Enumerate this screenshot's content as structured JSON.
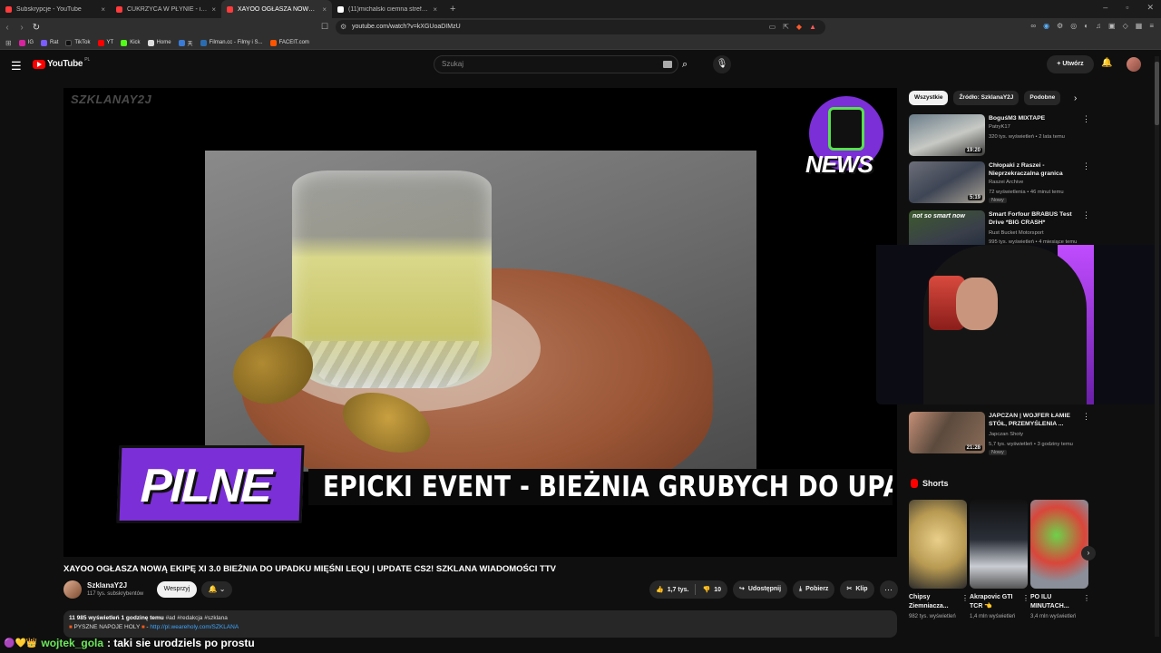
{
  "browser": {
    "tabs": [
      {
        "title": "Subskrypcje - YouTube",
        "color": "#ff3b3b",
        "active": false
      },
      {
        "title": "CUKRZYCA W PŁYNIE - ile kalorii ku...",
        "color": "#ff3b3b",
        "active": false
      },
      {
        "title": "XAYOO OGŁASZA NOWĄ EKI...",
        "color": "#ff3b3b",
        "active": true
      },
      {
        "title": "(11)michalski ciemna strefa (@micha...",
        "color": "#ffffff",
        "active": false
      }
    ],
    "new_tab": "+",
    "url": "youtube.com/watch?v=kXGUoaDIMzU",
    "bookmarks": [
      {
        "label": "IG",
        "color": "#d6249f"
      },
      {
        "label": "Rat",
        "color": "#7b5cff"
      },
      {
        "label": "TikTok",
        "color": "#111111"
      },
      {
        "label": "YT",
        "color": "#ff0000"
      },
      {
        "label": "Kick",
        "color": "#53fc18"
      },
      {
        "label": "Home",
        "color": "#dddddd"
      },
      {
        "label": "天",
        "color": "#3a7bd5"
      },
      {
        "label": "Filman.cc - Filmy i S...",
        "color": "#2b6cb0"
      },
      {
        "label": "FACEIT.com",
        "color": "#ff5500"
      }
    ]
  },
  "youtube": {
    "logo_text": "YouTube",
    "country": "PL",
    "search_placeholder": "Szukaj",
    "create_label": "Utwórz"
  },
  "video": {
    "watermark": "SZKLANAY2J",
    "news_logo": "NEWS",
    "badge": "PILNE",
    "ticker": "EPICKI EVENT - BIEŻNIA GRUBYCH DO UPADKU M",
    "title": "XAYOO OGŁASZA NOWĄ EKIPĘ XI 3.0 BIEŻNIA DO UPADKU MIĘŚNI LEQU | UPDATE CS2! SZKLANA WIADOMOŚCI TTV",
    "channel": "SzklanaY2J",
    "subscribers": "117 tys. subskrybentów",
    "support_label": "Wesprzyj",
    "likes": "1,7 tys.",
    "dislikes": "10",
    "share_label": "Udostępnij",
    "download_label": "Pobierz",
    "clip_label": "Klip",
    "desc_views": "11 985 wyświetleń  1 godzinę temu",
    "desc_tags": " #ad #redakcja #szklana",
    "desc_line2_prefix": "PYSZNE NAPOJE HOLY",
    "desc_line2_link": "http://pl.weareholy.com/SZKLANA"
  },
  "sidebar": {
    "chips": [
      "Wszystkie",
      "Źródło: SzklanaY2J",
      "Podobne"
    ],
    "recommendations": [
      {
        "title": "BoguśM3 MIXTAPE",
        "channel": "PatryK17",
        "meta": "320 tys. wyświetleń • 2 lata temu",
        "duration": "19:20",
        "badge": ""
      },
      {
        "title": "Chłopaki z Raszei - Nieprzekraczalna granica",
        "channel": "Raszei Archive",
        "meta": "72 wyświetlenia • 46 minut temu",
        "duration": "5:19",
        "badge": "Nowy"
      },
      {
        "title": "Smart Forfour BRABUS Test Drive *BIG CRASH*",
        "channel": "Rust Bucket Motorsport",
        "meta": "995 tys. wyświetleń • 4 miesiące temu",
        "duration": "",
        "badge": "",
        "thumb_text": "not so smart now"
      },
      {
        "title": "JAPCZAN | WOJFER ŁAMIE STÓŁ, PRZEMYŚLENIA ...",
        "channel": "Japczan Shoty",
        "meta": "5,7 tys. wyświetleń • 3 godziny temu",
        "duration": "21:28",
        "badge": "Nowy"
      }
    ],
    "shorts_title": "Shorts",
    "shorts": [
      {
        "title": "Chipsy Ziemniacza...",
        "views": "982 tys. wyświetleń"
      },
      {
        "title": "Akrapovic GTI TCR 👈",
        "views": "1,4 mln wyświetleń"
      },
      {
        "title": "PO ILU MINUTACH...",
        "views": "3,4 mln wyświetleń"
      }
    ]
  },
  "chat": {
    "badges": "🟣💛👑",
    "user": "wojtek_gola",
    "message": " : taki sie urodziels po prostu"
  }
}
